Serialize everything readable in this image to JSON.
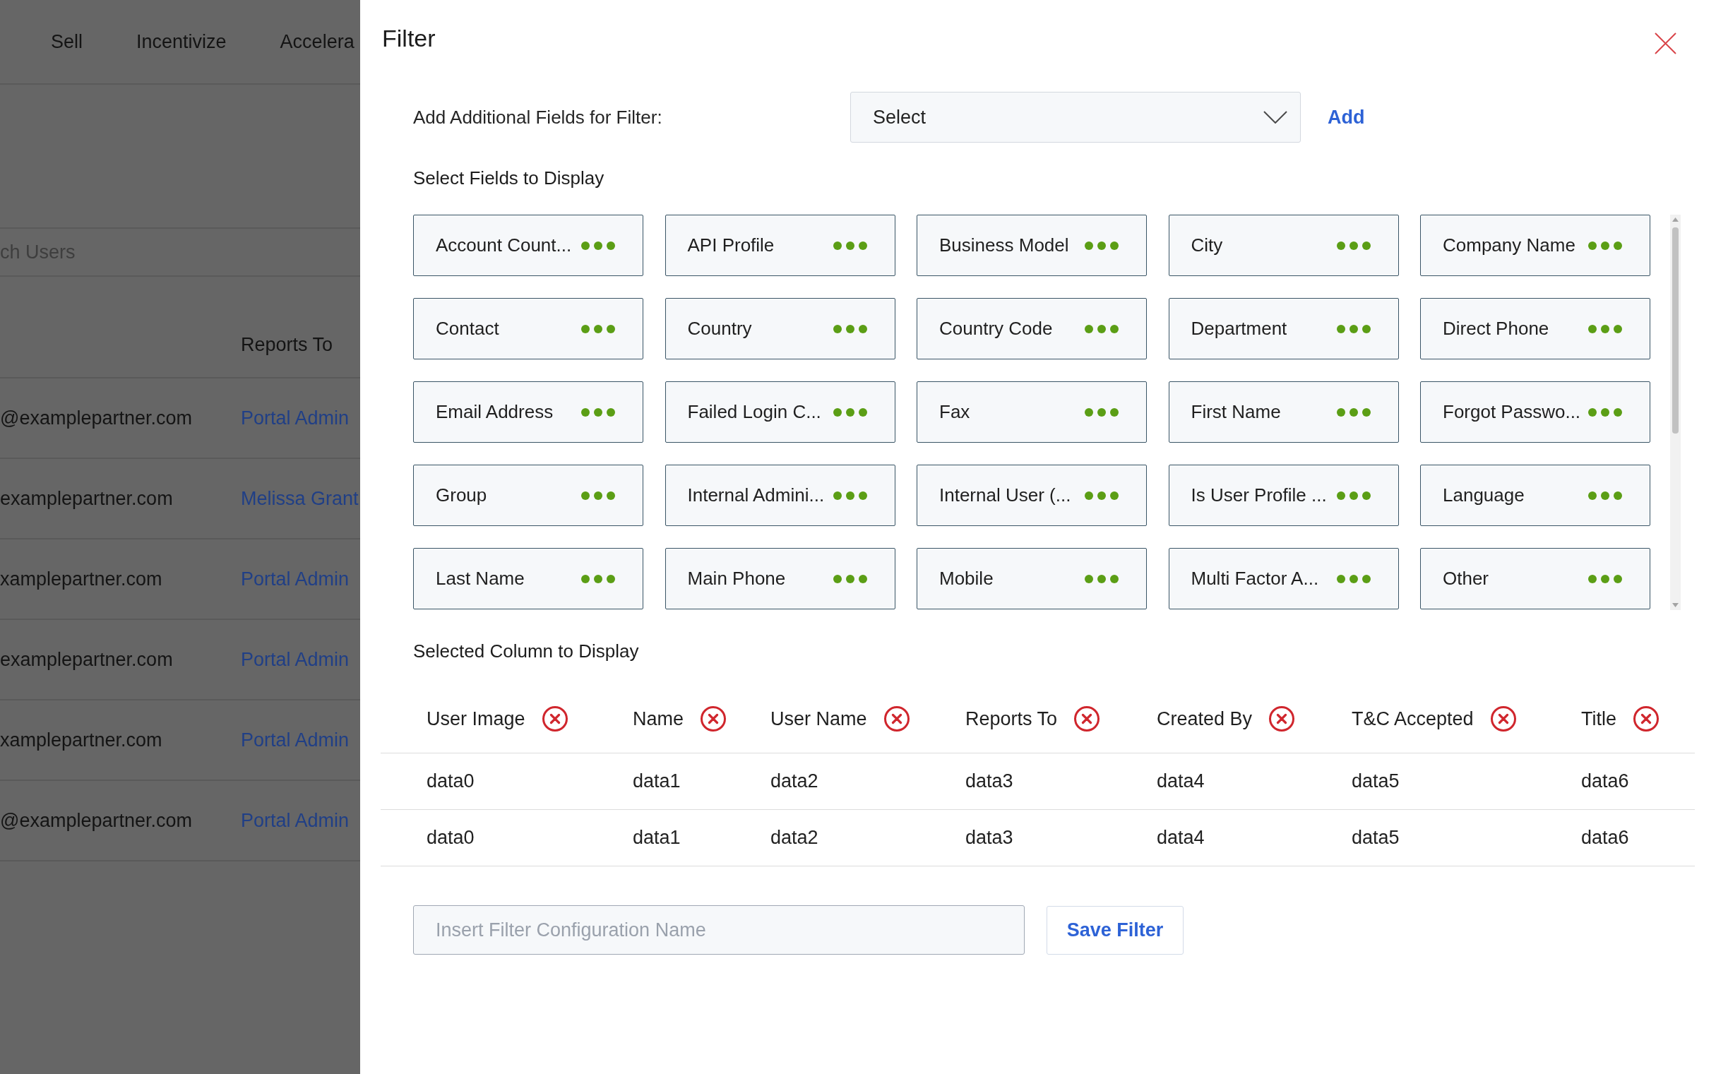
{
  "background_page": {
    "nav": [
      "Sell",
      "Incentivize",
      "Accelera"
    ],
    "search": {
      "placeholder": "ch Users"
    },
    "table": {
      "columns": [
        "Reports To"
      ],
      "rows": [
        {
          "column_1": "@examplepartner.com",
          "reports_to": "Portal Admin"
        },
        {
          "column_1": "examplepartner.com",
          "reports_to": "Melissa Grant"
        },
        {
          "column_1": "xamplepartner.com",
          "reports_to": "Portal Admin"
        },
        {
          "column_1": "examplepartner.com",
          "reports_to": "Portal Admin"
        },
        {
          "column_1": "xamplepartner.com",
          "reports_to": "Portal Admin"
        },
        {
          "column_1": "@examplepartner.com",
          "reports_to": "Portal Admin"
        }
      ]
    }
  },
  "filter_panel": {
    "title": "Filter",
    "add_fields": {
      "label": "Add Additional Fields for Filter:",
      "select": {
        "value": "Select"
      },
      "add_button": "Add"
    },
    "fields_section": {
      "heading": "Select Fields to Display",
      "fields": [
        "Account Count...",
        "API Profile",
        "Business Model",
        "City",
        "Company Name",
        "Contact",
        "Country",
        "Country Code",
        "Department",
        "Direct Phone",
        "Email Address",
        "Failed Login C...",
        "Fax",
        "First Name",
        "Forgot Passwo...",
        "Group",
        "Internal Admini...",
        "Internal User (...",
        "Is User Profile ...",
        "Language",
        "Last Name",
        "Main Phone",
        "Mobile",
        "Multi Factor A...",
        "Other"
      ]
    },
    "selected_section": {
      "heading": "Selected Column to Display",
      "columns": [
        "User Image",
        "Name",
        "User Name",
        "Reports To",
        "Created By",
        "T&C Accepted",
        "Title"
      ],
      "rows": [
        [
          "data0",
          "data1",
          "data2",
          "data3",
          "data4",
          "data5",
          "data6"
        ],
        [
          "data0",
          "data1",
          "data2",
          "data3",
          "data4",
          "data5",
          "data6"
        ]
      ]
    },
    "save": {
      "placeholder": "Insert Filter Configuration Name",
      "button": "Save Filter"
    }
  }
}
